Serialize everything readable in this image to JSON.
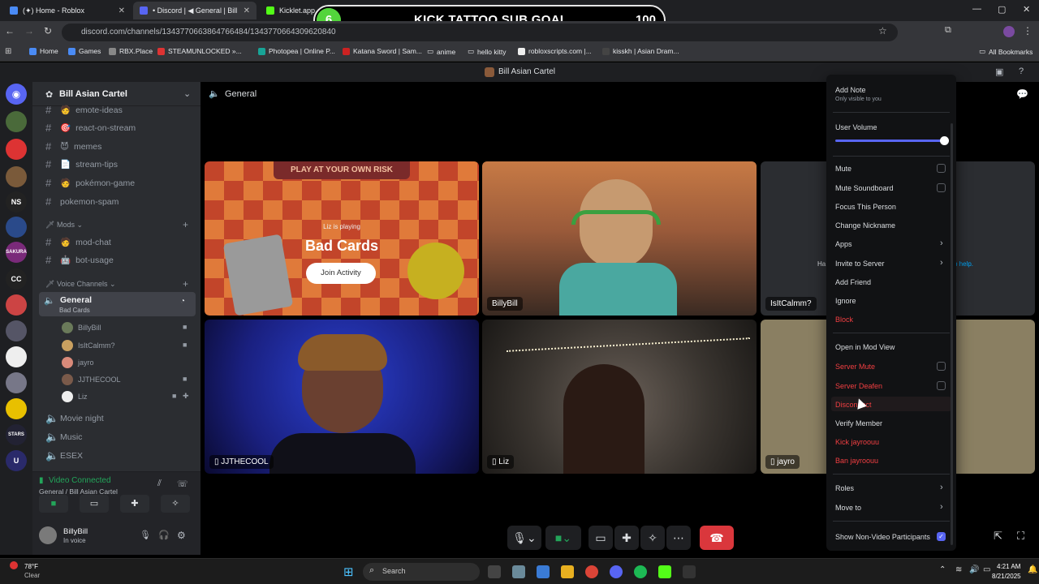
{
  "browser": {
    "tabs": [
      {
        "label": "(✦) Home - Roblox",
        "active": false
      },
      {
        "label": "• Discord | ◀ General | Bill",
        "active": true
      },
      {
        "label": "Kicklet.app - K... bot and ...",
        "active": false
      }
    ],
    "url": "discord.com/channels/1343770663864766484/1343770664309620840",
    "bookmarks": [
      "Home",
      "Games",
      "RBX.Place",
      "STEAMUNLOCKED »...",
      "Photopea | Online P...",
      "Katana Sword | Sam...",
      "anime",
      "hello kitty",
      "robloxscripts.com |...",
      "kisskh | Asian Dram...",
      "All Bookmarks"
    ]
  },
  "goal": {
    "current": "6",
    "title": "KICK TATTOO SUB GOAL",
    "target": "100",
    "progress": 0.06
  },
  "discord": {
    "window_title": "Bill Asian Cartel",
    "server_name": "Bill Asian Cartel",
    "channel_header": "General",
    "channels": [
      {
        "name": "emote-ideas",
        "emoji": "🧑"
      },
      {
        "name": "react-on-stream",
        "emoji": "🎯"
      },
      {
        "name": "memes",
        "emoji": "😈"
      },
      {
        "name": "stream-tips",
        "emoji": "📄"
      },
      {
        "name": "pokémon-game",
        "emoji": "🧑"
      },
      {
        "name": "pokemon-spam",
        "emoji": ""
      }
    ],
    "mods_category": "Mods",
    "mod_channels": [
      {
        "name": "mod-chat",
        "emoji": "🧑"
      },
      {
        "name": "bot-usage",
        "emoji": "🤖"
      }
    ],
    "voice_category": "Voice Channels",
    "voice_general": {
      "name": "General",
      "activity": "Bad Cards"
    },
    "voice_users": [
      "BillyBill",
      "IsItCalmm?",
      "jayro",
      "JJTHECOOL",
      "Liz"
    ],
    "other_voice": [
      "Movie night",
      "Music",
      "ESEX"
    ],
    "voice_status": "Video Connected",
    "voice_location": "General / Bill Asian Cartel",
    "user": {
      "name": "BillyBill",
      "status": "In voice"
    },
    "tiles": {
      "activity_banner": "PLAY AT YOUR OWN RISK",
      "activity_sub": "Liz is playing",
      "activity_title": "Bad Cards",
      "join_label": "Join Activity",
      "billybill": "BillyBill",
      "isitcalmm": "IsItCalmm?",
      "jjthecool": "JJTHECOOL",
      "liz": "Liz",
      "jayro": "jayro",
      "help_left": "Ha",
      "help_right": "p help."
    }
  },
  "menu": {
    "add_note": "Add Note",
    "add_note_sub": "Only visible to you",
    "user_volume": "User Volume",
    "volume": 1.0,
    "mute": "Mute",
    "mute_soundboard": "Mute Soundboard",
    "focus": "Focus This Person",
    "change_nick": "Change Nickname",
    "apps": "Apps",
    "invite": "Invite to Server",
    "add_friend": "Add Friend",
    "ignore": "Ignore",
    "block": "Block",
    "mod_view": "Open in Mod View",
    "server_mute": "Server Mute",
    "server_deafen": "Server Deafen",
    "disconnect": "Disconnect",
    "verify": "Verify Member",
    "kick": "Kick jayroouu",
    "ban": "Ban jayroouu",
    "roles": "Roles",
    "move_to": "Move to",
    "show_non_video": "Show Non-Video Participants"
  },
  "taskbar": {
    "weather_temp": "78°F",
    "weather_desc": "Clear",
    "search": "Search",
    "time": "4:21 AM",
    "date": "8/21/2025"
  }
}
